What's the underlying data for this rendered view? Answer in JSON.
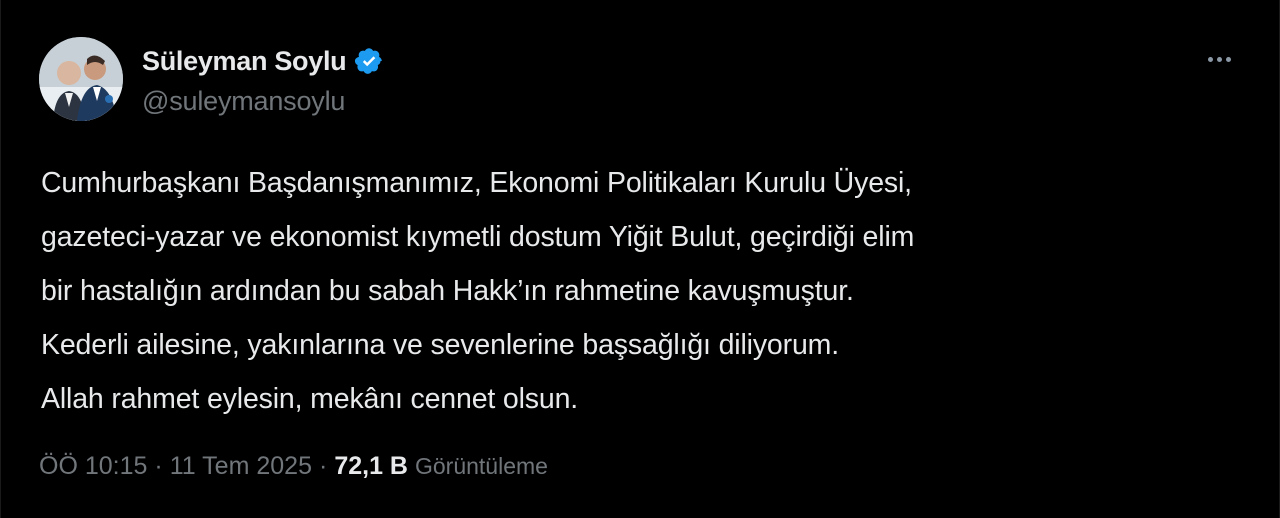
{
  "author": {
    "display_name": "Süleyman Soylu",
    "handle": "@suleymansoylu",
    "verified_badge_icon": "verified-badge-icon",
    "badge_color": "#1d9bf0"
  },
  "tweet": {
    "lines": [
      "Cumhurbaşkanı Başdanışmanımız, Ekonomi Politikaları Kurulu Üyesi,",
      "gazeteci-yazar ve ekonomist kıymetli dostum Yiğit Bulut, geçirdiği elim",
      "bir hastalığın ardından bu sabah Hakk’ın rahmetine kavuşmuştur.",
      "Kederli ailesine, yakınlarına ve sevenlerine başsağlığı diliyorum.",
      "Allah rahmet eylesin, mekânı cennet olsun."
    ]
  },
  "meta": {
    "time": "ÖÖ 10:15",
    "separator": "·",
    "date": "11 Tem 2025",
    "views_count": "72,1 B",
    "views_label": "Görüntüleme"
  },
  "actions": {
    "more_icon": "more-dots-icon"
  },
  "colors": {
    "background": "#000000",
    "primary_text": "#e7e9ea",
    "secondary_text": "#71767b"
  }
}
